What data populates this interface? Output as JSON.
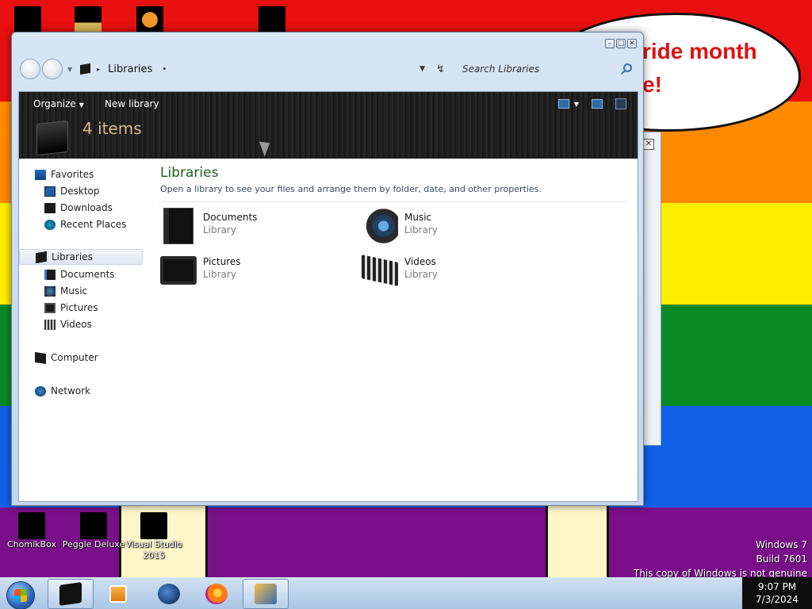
{
  "desktop": {
    "speech_text": "ride month\ne!",
    "icons": [
      {
        "label": "ChomikBox"
      },
      {
        "label": "Peggle Deluxe"
      },
      {
        "label": "Visual Studio 2015"
      }
    ],
    "watermark": {
      "line1": "Windows 7",
      "line2": "Build 7601",
      "line3": "This copy of Windows is not genuine"
    }
  },
  "window": {
    "address": {
      "current": "Libraries"
    },
    "search": {
      "placeholder": "Search Libraries"
    },
    "toolbar": {
      "organize_label": "Organize",
      "new_library_label": "New library"
    },
    "items_count": "4 items",
    "sidebar": {
      "favorites_label": "Favorites",
      "favorites": [
        "Desktop",
        "Downloads",
        "Recent Places"
      ],
      "libraries_label": "Libraries",
      "libraries": [
        "Documents",
        "Music",
        "Pictures",
        "Videos"
      ],
      "computer_label": "Computer",
      "network_label": "Network"
    },
    "main": {
      "title": "Libraries",
      "description": "Open a library to see your files and arrange them by folder, date, and other properties.",
      "tiles": [
        {
          "name": "Documents",
          "type": "Library",
          "icon": "documents-library-icon"
        },
        {
          "name": "Music",
          "type": "Library",
          "icon": "music-library-icon"
        },
        {
          "name": "Pictures",
          "type": "Library",
          "icon": "pictures-library-icon"
        },
        {
          "name": "Videos",
          "type": "Library",
          "icon": "videos-library-icon"
        }
      ]
    }
  },
  "taskbar": {
    "clock": {
      "time": "9:07 PM",
      "date": "7/3/2024"
    }
  },
  "colors": {
    "toolbar_bg": "#1b1b1b",
    "main_title": "#1e5d1e",
    "taskbar_bg": "#cfe0f2",
    "speech_text": "#e01010"
  }
}
